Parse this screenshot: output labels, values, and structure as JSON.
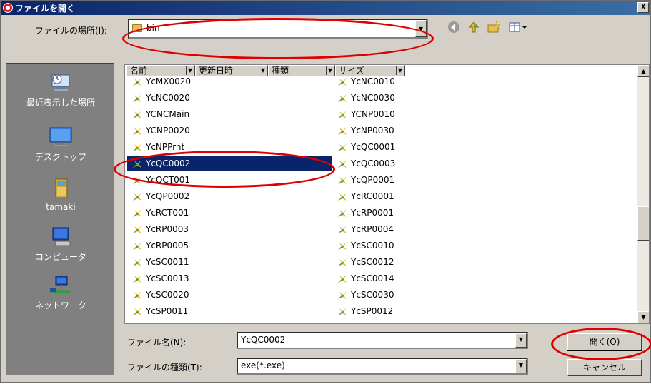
{
  "window": {
    "title": "ファイルを開く",
    "close_label": "X"
  },
  "location": {
    "label": "ファイルの場所(I):",
    "value": "bin"
  },
  "places": [
    {
      "name": "recent",
      "label": "最近表示した場所"
    },
    {
      "name": "desktop",
      "label": "デスクトップ"
    },
    {
      "name": "user",
      "label": "tamaki"
    },
    {
      "name": "computer",
      "label": "コンピュータ"
    },
    {
      "name": "network",
      "label": "ネットワーク"
    }
  ],
  "columns": [
    "名前",
    "更新日時",
    "種類",
    "サイズ"
  ],
  "files_col1": [
    "YcMX0020",
    "YcNC0020",
    "YCNCMain",
    "YCNP0020",
    "YcNPPrnt",
    "YcQC0002",
    "YcQCT001",
    "YcQP0002",
    "YcRCT001",
    "YcRP0003",
    "YcRP0005",
    "YcSC0011",
    "YcSC0013",
    "YcSC0020",
    "YcSP0011"
  ],
  "files_col2": [
    "YcNC0010",
    "YcNC0030",
    "YCNP0010",
    "YcNP0030",
    "YcQC0001",
    "YcQC0003",
    "YcQP0001",
    "YcRC0001",
    "YcRP0001",
    "YcRP0004",
    "YcSC0010",
    "YcSC0012",
    "YcSC0014",
    "YcSC0030",
    "YcSP0012"
  ],
  "selected_file": "YcQC0002",
  "filename": {
    "label": "ファイル名(N):",
    "value": "YcQC0002"
  },
  "filetype": {
    "label": "ファイルの種類(T):",
    "value": "exe(*.exe)"
  },
  "buttons": {
    "open": "開く(O)",
    "cancel": "キャンセル"
  },
  "colors": {
    "selection": "#0a246a",
    "highlight_ellipse": "#e00000",
    "places_bg": "#808080"
  }
}
